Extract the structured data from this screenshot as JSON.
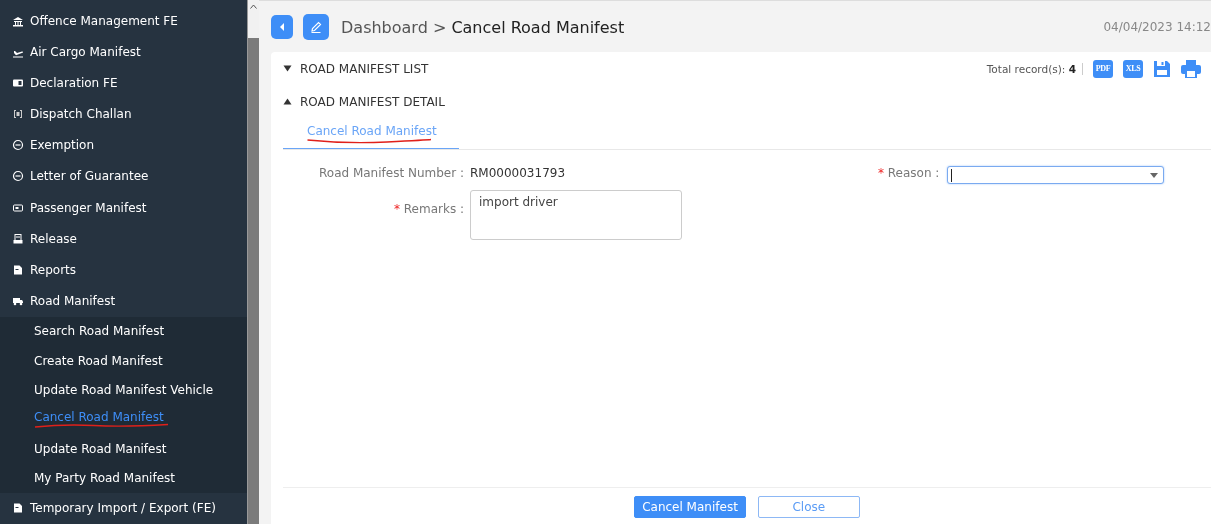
{
  "sidebar": {
    "items": [
      {
        "label": "Offence Management FE"
      },
      {
        "label": "Air Cargo Manifest"
      },
      {
        "label": "Declaration FE"
      },
      {
        "label": "Dispatch Challan"
      },
      {
        "label": "Exemption"
      },
      {
        "label": "Letter of Guarantee"
      },
      {
        "label": "Passenger Manifest"
      },
      {
        "label": "Release"
      },
      {
        "label": "Reports"
      },
      {
        "label": "Road Manifest",
        "children": [
          {
            "label": "Search Road Manifest",
            "selected": false,
            "annotated": false
          },
          {
            "label": "Create Road Manifest",
            "selected": false,
            "annotated": false
          },
          {
            "label": "Update Road Manifest Vehicle",
            "selected": false,
            "annotated": false
          },
          {
            "label": "Cancel Road Manifest",
            "selected": true,
            "annotated": true
          },
          {
            "label": "Update Road Manifest",
            "selected": false,
            "annotated": false
          },
          {
            "label": "My Party Road Manifest",
            "selected": false,
            "annotated": false
          }
        ]
      },
      {
        "label": "Temporary Import / Export (FE)"
      }
    ]
  },
  "header": {
    "breadcrumb": {
      "parent": "Dashboard",
      "separator": ">",
      "current": "Cancel Road Manifest"
    },
    "datetime": "04/04/2023 14:12"
  },
  "sections": [
    {
      "title": "ROAD MANIFEST LIST",
      "expanded": false
    },
    {
      "title": "ROAD MANIFEST DETAIL",
      "expanded": true
    }
  ],
  "toolbar": {
    "total_label": "Total record(s):",
    "total": "4",
    "export_buttons": [
      {
        "kind": "pdf",
        "label": "PDF"
      },
      {
        "kind": "xls",
        "label": "XLS"
      },
      {
        "kind": "save"
      },
      {
        "kind": "print"
      }
    ]
  },
  "tabs": [
    {
      "label": "Cancel Road Manifest",
      "selected": true,
      "annotated": true
    }
  ],
  "form": {
    "manifest_number": {
      "label": "Road Manifest Number :",
      "value": "RM0000031793"
    },
    "reason": {
      "label": "Reason :",
      "required_mark": "*",
      "focused": true
    },
    "remarks": {
      "label": "Remarks :",
      "required_mark": "*",
      "value": "import driver"
    }
  },
  "buttons": [
    {
      "label": "Cancel Manifest",
      "kind": "primary"
    },
    {
      "label": "Close",
      "kind": "secondary"
    }
  ]
}
